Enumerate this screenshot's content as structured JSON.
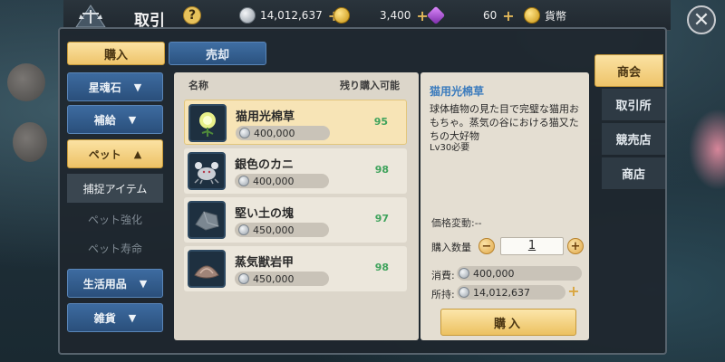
{
  "header": {
    "title": "取引",
    "help_label": "?",
    "currencies": [
      {
        "name": "silver",
        "value": "14,012,637",
        "icon": "silver-coin-icon",
        "color": "#c9d0d6"
      },
      {
        "name": "gold",
        "value": "3,400",
        "icon": "gold-coin-icon",
        "color": "#e8b931"
      },
      {
        "name": "gem",
        "value": "60",
        "icon": "purple-gem-icon",
        "color": "#b35ad6"
      }
    ],
    "currency_tab_label": "貨幣",
    "close_label": "✕"
  },
  "top_tabs": {
    "buy": "購入",
    "sell": "売却"
  },
  "categories": {
    "star_soul": "星魂石",
    "supply": "補給",
    "pet": "ペット",
    "pet_sub": [
      "捕捉アイテム",
      "ペット強化",
      "ペット寿命"
    ],
    "life": "生活用品",
    "misc": "雑貨"
  },
  "list": {
    "col_name": "名称",
    "col_remaining": "残り購入可能",
    "items": [
      {
        "name": "猫用光棉草",
        "price": "400,000",
        "remaining": "95",
        "icon": "glowing-flower-icon"
      },
      {
        "name": "銀色のカニ",
        "price": "400,000",
        "remaining": "98",
        "icon": "silver-crab-icon"
      },
      {
        "name": "堅い土の塊",
        "price": "450,000",
        "remaining": "97",
        "icon": "earth-clod-icon"
      },
      {
        "name": "蒸気獣岩甲",
        "price": "450,000",
        "remaining": "98",
        "icon": "steam-beast-shell-icon"
      }
    ]
  },
  "detail": {
    "title": "猫用光棉草",
    "description": "球体植物の見た目で完璧な猫用おもちゃ。蒸気の谷における猫又たちの大好物",
    "requirement": "Lv30必要",
    "price_change": "価格変動:--",
    "qty_label": "購入数量",
    "qty_value": "1",
    "cost_label": "消費:",
    "cost_value": "400,000",
    "owned_label": "所持:",
    "owned_value": "14,012,637",
    "buy_label": "購入"
  },
  "right_tabs": [
    "商会",
    "取引所",
    "競売店",
    "商店"
  ],
  "colors": {
    "accent_gold": "#eec46a",
    "accent_blue": "#2b527f",
    "remaining_green": "#3fa35c",
    "title_blue": "#3b7bbd"
  }
}
